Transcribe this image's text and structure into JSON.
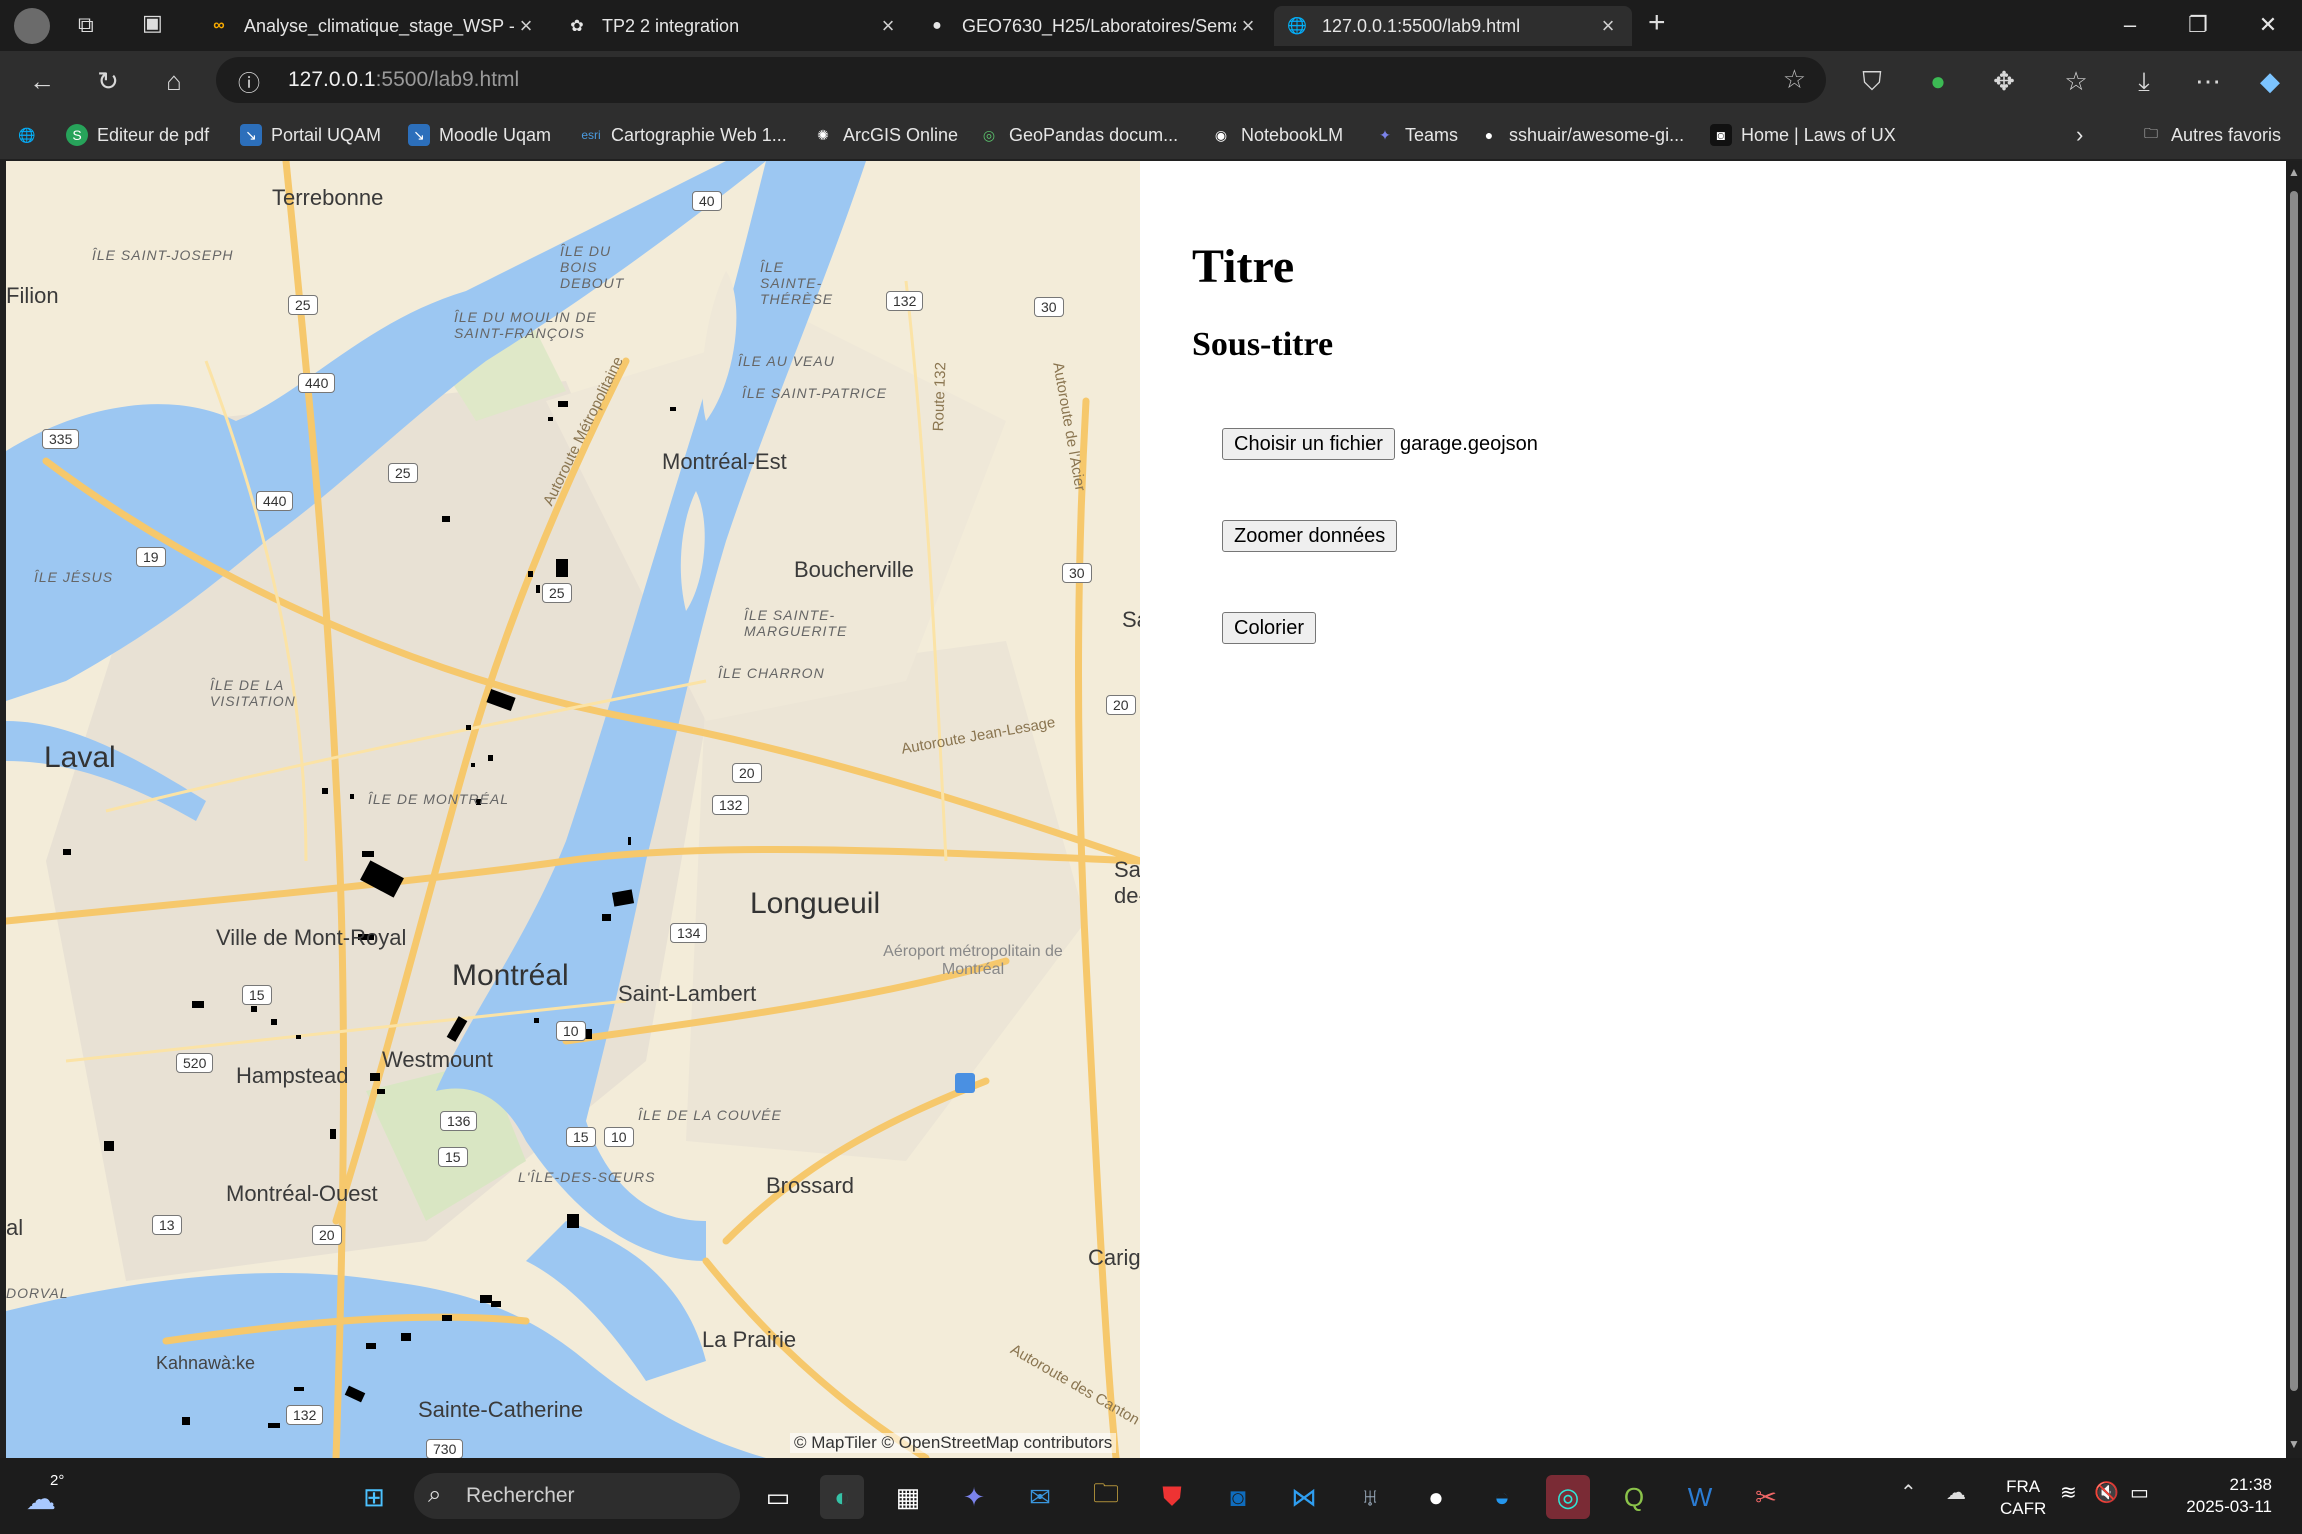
{
  "browser": {
    "tabs": [
      {
        "title": "Analyse_climatique_stage_WSP - (",
        "icon": "colab-icon"
      },
      {
        "title": "TP2 2 integration",
        "icon": "chatgpt-icon"
      },
      {
        "title": "GEO7630_H25/Laboratoires/Sema",
        "icon": "github-icon"
      },
      {
        "title": "127.0.0.1:5500/lab9.html",
        "icon": "globe-icon",
        "active": true
      }
    ],
    "address": {
      "host": "127.0.0.1",
      "rest": ":5500/lab9.html"
    },
    "bookmarks": [
      "Editeur de pdf",
      "Portail UQAM",
      "Moodle Uqam",
      "Cartographie Web 1...",
      "ArcGIS Online",
      "GeoPandas docum...",
      "NotebookLM",
      "Teams",
      "sshuair/awesome-gi...",
      "Home | Laws of UX"
    ],
    "other_bookmarks": "Autres favoris"
  },
  "page": {
    "title": "Titre",
    "subtitle": "Sous-titre",
    "file_button": "Choisir un fichier",
    "file_name": "garage.geojson",
    "zoom_button": "Zoomer données",
    "color_button": "Colorier"
  },
  "map": {
    "attribution": "© MapTiler © OpenStreetMap contributors",
    "labels": {
      "terrebonne": "Terrebonne",
      "ile_saint_joseph": "ÎLE SAINT-JOSEPH",
      "filion": "Filion",
      "ile_du_bois_debout": "ÎLE DU BOIS DEBOUT",
      "ile_sainte_therese": "ÎLE SAINTE-THÉRÈSE",
      "ile_moulin": "ÎLE DU MOULIN DE SAINT-FRANÇOIS",
      "ile_au_veau": "ÎLE AU VEAU",
      "ile_saint_patrice": "ÎLE SAINT-PATRICE",
      "montreal_est": "Montréal-Est",
      "boucherville": "Boucherville",
      "ile_sainte_marguerite": "ÎLE SAINTE-MARGUERITE",
      "ile_charron": "ÎLE CHARRON",
      "ile_jesus": "ÎLE JÉSUS",
      "ile_visitation": "ÎLE DE LA VISITATION",
      "laval": "Laval",
      "ile_de_montreal": "ÎLE DE MONTRÉAL",
      "longueuil": "Longueuil",
      "mont_royal": "Ville de Mont-Royal",
      "montreal": "Montréal",
      "saint_lambert": "Saint-Lambert",
      "airport": "Aéroport métropolitain de Montréal",
      "hampstead": "Hampstead",
      "westmount": "Westmount",
      "ile_de_la_couvee": "ÎLE DE LA COUVÉE",
      "ile_des_soeurs": "L'ÎLE-DES-SŒURS",
      "brossard": "Brossard",
      "montreal_ouest": "Montréal-Ouest",
      "carig": "Carig",
      "dorval": "DORVAL",
      "la_prairie": "La Prairie",
      "kahnawake": "Kahnawà:ke",
      "sainte_catherine": "Sainte-Catherine",
      "sa": "Sa",
      "sa_de": "Sa de-",
      "al": "al",
      "road_metro": "Autoroute Métropolitaine",
      "road_132": "Route 132",
      "road_acier": "Autoroute de l'Acier",
      "road_jean_lesage": "Autoroute Jean-Lesage",
      "road_cantons": "Autoroute des Canton"
    },
    "shields": [
      "40",
      "25",
      "440",
      "335",
      "440",
      "25",
      "19",
      "25",
      "132",
      "30",
      "30",
      "20",
      "20",
      "132",
      "134",
      "15",
      "520",
      "10",
      "136",
      "15",
      "10",
      "15",
      "13",
      "20",
      "132",
      "730"
    ]
  },
  "taskbar": {
    "weather": "2°",
    "search_placeholder": "Rechercher",
    "lang": "FRA",
    "layout": "CAFR",
    "time": "21:38",
    "date": "2025-03-11"
  }
}
